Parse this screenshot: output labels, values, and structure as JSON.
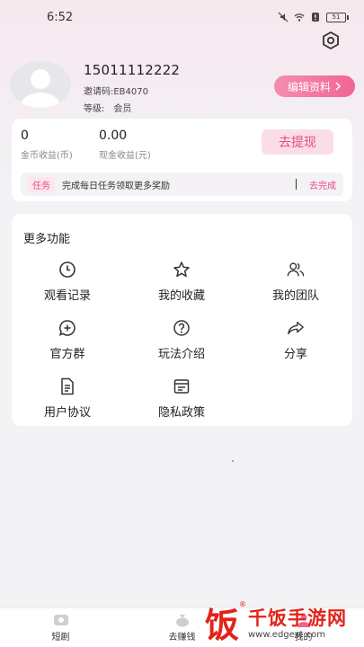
{
  "status_bar": {
    "time": "6:52",
    "battery": "51"
  },
  "profile": {
    "phone": "15011112222",
    "invite_code": "邀请码:EB4070",
    "level_label": "等级:",
    "level_value": "会员",
    "edit_label": "编辑资料"
  },
  "earnings": {
    "coin_value": "0",
    "coin_label": "金币收益(币)",
    "cash_value": "0.00",
    "cash_label": "现金收益(元)",
    "withdraw_label": "去提现",
    "task_tag": "任务",
    "task_text": "完成每日任务领取更多奖励",
    "task_go": "去完成"
  },
  "features": {
    "title": "更多功能",
    "items": [
      {
        "label": "观看记录",
        "icon": "clock-icon"
      },
      {
        "label": "我的收藏",
        "icon": "star-icon"
      },
      {
        "label": "我的团队",
        "icon": "team-icon"
      },
      {
        "label": "官方群",
        "icon": "chat-plus-icon"
      },
      {
        "label": "玩法介绍",
        "icon": "question-icon"
      },
      {
        "label": "分享",
        "icon": "share-icon"
      },
      {
        "label": "用户协议",
        "icon": "document-icon"
      },
      {
        "label": "隐私政策",
        "icon": "policy-icon"
      }
    ]
  },
  "bottom_nav": [
    {
      "label": "短剧",
      "icon": "drama-icon"
    },
    {
      "label": "去赚钱",
      "icon": "money-bag-icon"
    },
    {
      "label": "我的",
      "icon": "user-icon"
    }
  ],
  "watermark": {
    "logo_char": "饭",
    "main": "千饭手游网",
    "sub": "www.edgext.com"
  },
  "colors": {
    "accent": "#f06595",
    "accent_light": "#fbdde8",
    "watermark": "#e2231a"
  }
}
